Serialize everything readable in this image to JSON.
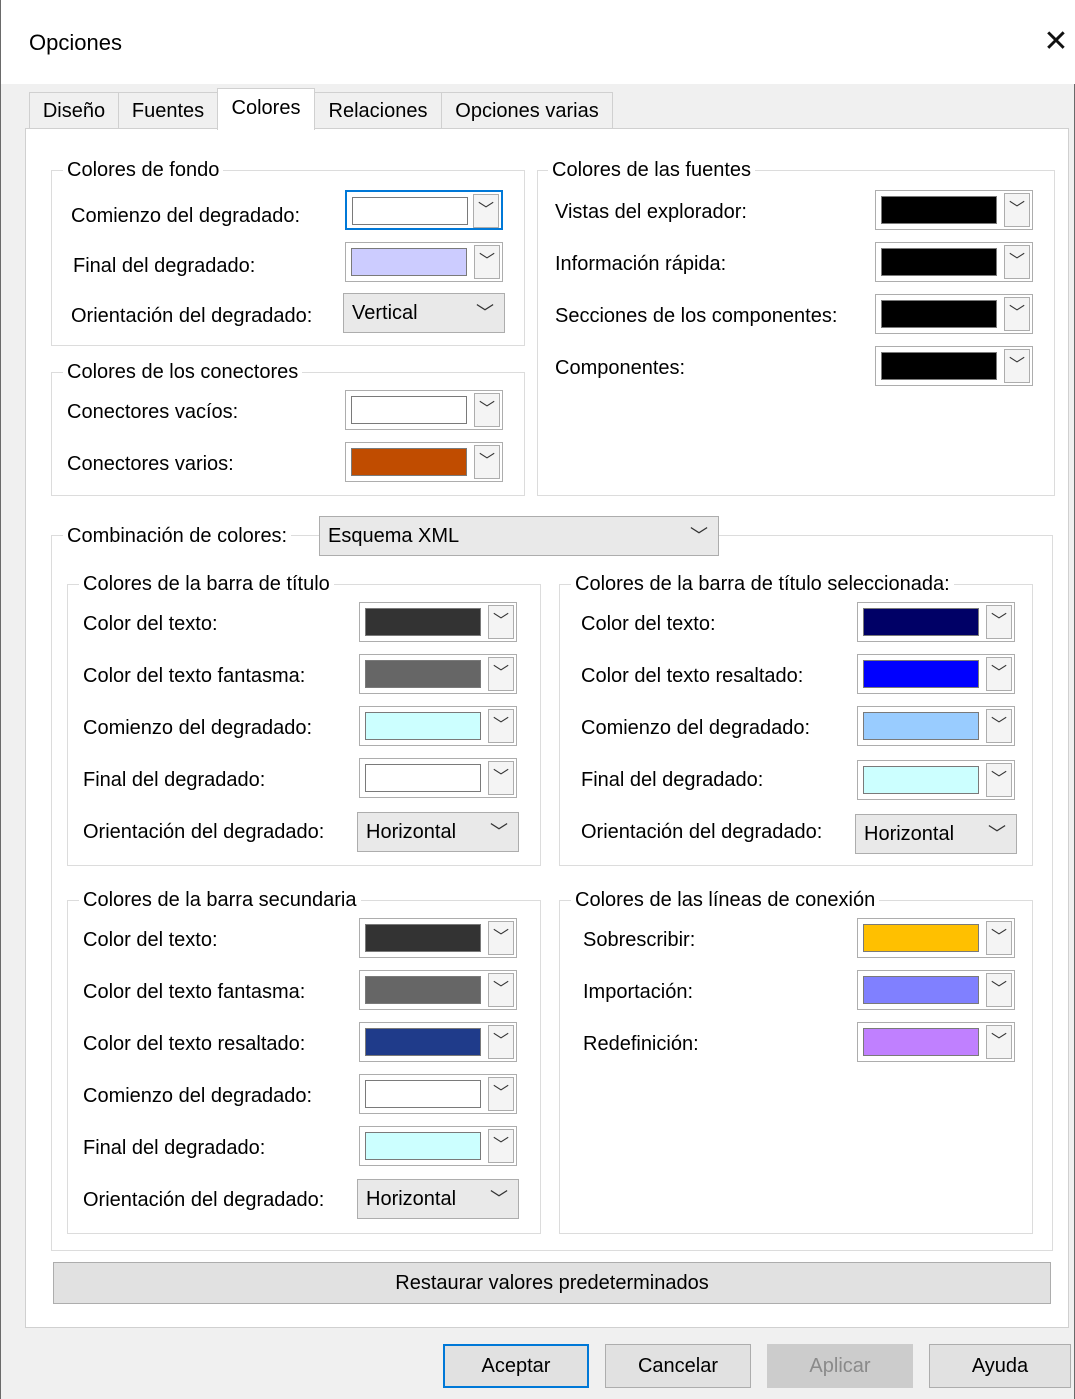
{
  "window": {
    "title": "Opciones"
  },
  "tabs": [
    "Diseño",
    "Fuentes",
    "Colores",
    "Relaciones",
    "Opciones varias"
  ],
  "background_colors": {
    "legend": "Colores de fondo",
    "gradient_start": {
      "label": "Comienzo del degradado:",
      "color": "#ffffff"
    },
    "gradient_end": {
      "label": "Final del degradado:",
      "color": "#ccccff"
    },
    "orientation": {
      "label": "Orientación del degradado:",
      "value": "Vertical"
    }
  },
  "connector_colors": {
    "legend": "Colores de los conectores",
    "empty": {
      "label": "Conectores vacíos:",
      "color": "#ffffff"
    },
    "various": {
      "label": "Conectores varios:",
      "color": "#c04c00"
    }
  },
  "font_colors": {
    "legend": "Colores de las fuentes",
    "explorer": {
      "label": "Vistas del explorador:",
      "color": "#000000"
    },
    "quickinfo": {
      "label": "Información rápida:",
      "color": "#000000"
    },
    "sections": {
      "label": "Secciones de los componentes:",
      "color": "#000000"
    },
    "components": {
      "label": "Componentes:",
      "color": "#000000"
    }
  },
  "scheme": {
    "label": "Combinación de colores:",
    "value": "Esquema XML"
  },
  "titlebar_colors": {
    "legend": "Colores de la barra de título",
    "text": {
      "label": "Color del texto:",
      "color": "#333333"
    },
    "ghost": {
      "label": "Color del texto fantasma:",
      "color": "#666666"
    },
    "gradient_start": {
      "label": "Comienzo del degradado:",
      "color": "#ccffff"
    },
    "gradient_end": {
      "label": "Final del degradado:",
      "color": "#ffffff"
    },
    "orientation": {
      "label": "Orientación del degradado:",
      "value": "Horizontal"
    }
  },
  "selected_titlebar_colors": {
    "legend": "Colores de la barra de título seleccionada:",
    "text": {
      "label": "Color del texto:",
      "color": "#000066"
    },
    "highlight": {
      "label": "Color del texto resaltado:",
      "color": "#0000ff"
    },
    "gradient_start": {
      "label": "Comienzo del degradado:",
      "color": "#99ccff"
    },
    "gradient_end": {
      "label": "Final del degradado:",
      "color": "#ccffff"
    },
    "orientation": {
      "label": "Orientación del degradado:",
      "value": "Horizontal"
    }
  },
  "secondary_bar_colors": {
    "legend": "Colores de la barra secundaria",
    "text": {
      "label": "Color del texto:",
      "color": "#333333"
    },
    "ghost": {
      "label": "Color del texto fantasma:",
      "color": "#666666"
    },
    "highlight": {
      "label": "Color del texto resaltado:",
      "color": "#1f3b8a"
    },
    "gradient_start": {
      "label": "Comienzo del degradado:",
      "color": "#ffffff"
    },
    "gradient_end": {
      "label": "Final del degradado:",
      "color": "#ccffff"
    },
    "orientation": {
      "label": "Orientación del degradado:",
      "value": "Horizontal"
    }
  },
  "connection_line_colors": {
    "legend": "Colores de las líneas de conexión",
    "overwrite": {
      "label": "Sobrescribir:",
      "color": "#ffc000"
    },
    "import": {
      "label": "Importación:",
      "color": "#8080ff"
    },
    "redefine": {
      "label": "Redefinición:",
      "color": "#c080ff"
    }
  },
  "restore_button": "Restaurar valores predeterminados",
  "buttons": {
    "ok": "Aceptar",
    "cancel": "Cancelar",
    "apply": "Aplicar",
    "help": "Ayuda"
  }
}
